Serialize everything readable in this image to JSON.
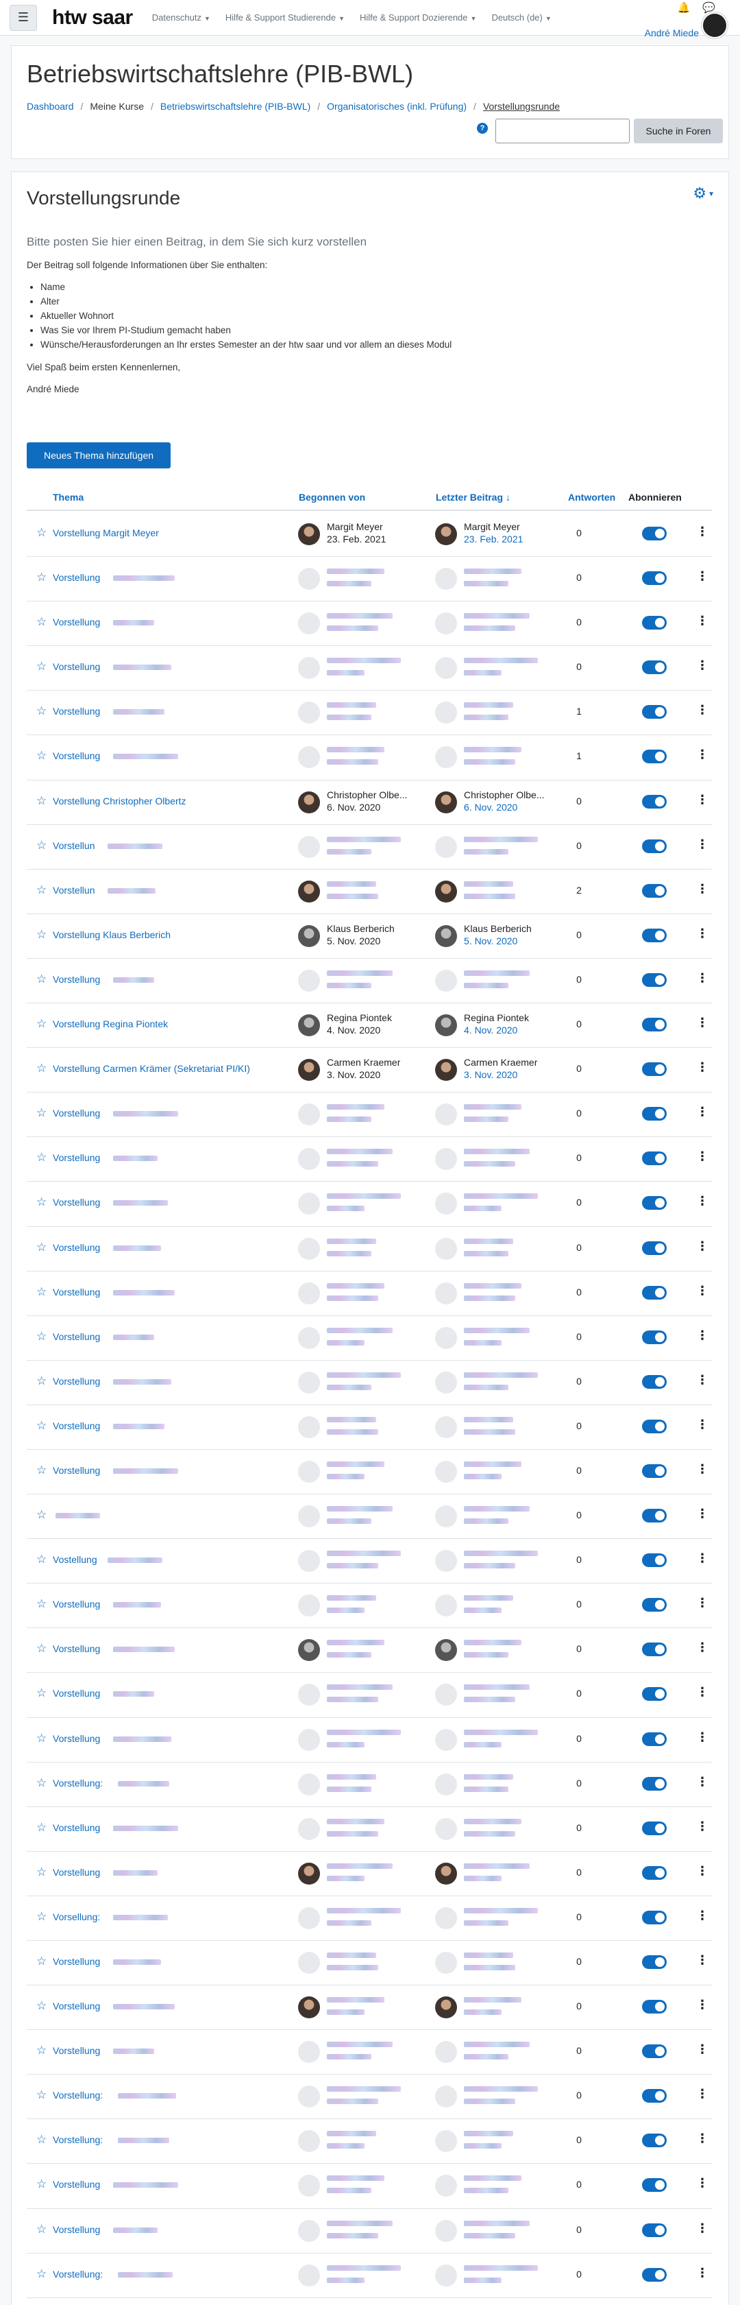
{
  "navbar": {
    "brand": "htw saar",
    "menu_icon": "hamburger-icon",
    "items": [
      {
        "label": "Datenschutz"
      },
      {
        "label": "Hilfe & Support Studierende"
      },
      {
        "label": "Hilfe & Support Dozierende"
      },
      {
        "label": "Deutsch (de)"
      }
    ],
    "user_name": "André Miede"
  },
  "header": {
    "title": "Betriebswirtschaftslehre (PIB-BWL)",
    "breadcrumb": [
      {
        "label": "Dashboard",
        "link": true
      },
      {
        "label": "Meine Kurse",
        "link": false
      },
      {
        "label": "Betriebswirtschaftslehre (PIB-BWL)",
        "link": true
      },
      {
        "label": "Organisatorisches (inkl. Prüfung)",
        "link": true
      },
      {
        "label": "Vorstellungsrunde",
        "link": false
      }
    ],
    "search_placeholder": "",
    "search_button": "Suche in Foren"
  },
  "forum": {
    "title": "Vorstellungsrunde",
    "intro_lead": "Bitte posten Sie hier einen Beitrag, in dem Sie sich kurz vorstellen",
    "intro_text": "Der Beitrag soll folgende Informationen über Sie enthalten:",
    "intro_items": [
      "Name",
      "Alter",
      "Aktueller Wohnort",
      "Was Sie vor Ihrem PI-Studium gemacht haben",
      "Wünsche/Herausforderungen an Ihr erstes Semester an der htw saar und vor allem an dieses Modul"
    ],
    "closing": "Viel Spaß beim ersten Kennenlernen,",
    "signature": "André Miede",
    "add_button": "Neues Thema hinzufügen"
  },
  "table": {
    "headers": {
      "topic": "Thema",
      "started_by": "Begonnen von",
      "last_post": "Letzter Beitrag",
      "replies": "Antworten",
      "subscribe": "Abonnieren"
    },
    "rows": [
      {
        "topic": "Vorstellung Margit Meyer",
        "starter": "Margit Meyer",
        "start_date": "23. Feb. 2021",
        "last": "Margit Meyer",
        "last_date": "23. Feb. 2021",
        "replies": "0",
        "avatar": "photo"
      },
      {
        "topic": "Vorstellung",
        "starter": "",
        "start_date": "",
        "last": "",
        "last_date": "",
        "replies": "0",
        "avatar": "blank"
      },
      {
        "topic": "Vorstellung",
        "starter": "",
        "start_date": "",
        "last": "",
        "last_date": "",
        "replies": "0",
        "avatar": "blank"
      },
      {
        "topic": "Vorstellung",
        "starter": "",
        "start_date": "",
        "last": "",
        "last_date": "",
        "replies": "0",
        "avatar": "blank"
      },
      {
        "topic": "Vorstellung",
        "starter": "",
        "start_date": "",
        "last": "",
        "last_date": "",
        "replies": "1",
        "avatar": "blank"
      },
      {
        "topic": "Vorstellung",
        "starter": "",
        "start_date": "",
        "last": "",
        "last_date": "",
        "replies": "1",
        "avatar": "blank"
      },
      {
        "topic": "Vorstellung Christopher Olbertz",
        "starter": "Christopher Olbe...",
        "start_date": "6. Nov. 2020",
        "last": "Christopher Olbe...",
        "last_date": "6. Nov. 2020",
        "replies": "0",
        "avatar": "photo"
      },
      {
        "topic": "Vorstellun",
        "starter": "",
        "start_date": "",
        "last": "",
        "last_date": "",
        "replies": "0",
        "avatar": "blank"
      },
      {
        "topic": "Vorstellun",
        "starter": "",
        "start_date": "",
        "last": "",
        "last_date": "",
        "replies": "2",
        "avatar": "photo"
      },
      {
        "topic": "Vorstellung Klaus Berberich",
        "starter": "Klaus Berberich",
        "start_date": "5. Nov. 2020",
        "last": "Klaus Berberich",
        "last_date": "5. Nov. 2020",
        "replies": "0",
        "avatar": "grey"
      },
      {
        "topic": "Vorstellung",
        "starter": "",
        "start_date": "",
        "last": "",
        "last_date": "",
        "replies": "0",
        "avatar": "blank"
      },
      {
        "topic": "Vorstellung Regina Piontek",
        "starter": "Regina Piontek",
        "start_date": "4. Nov. 2020",
        "last": "Regina Piontek",
        "last_date": "4. Nov. 2020",
        "replies": "0",
        "avatar": "grey"
      },
      {
        "topic": "Vorstellung Carmen Krämer (Sekretariat PI/KI)",
        "starter": "Carmen Kraemer",
        "start_date": "3. Nov. 2020",
        "last": "Carmen Kraemer",
        "last_date": "3. Nov. 2020",
        "replies": "0",
        "avatar": "photo"
      },
      {
        "topic": "Vorstellung",
        "starter": "",
        "start_date": "",
        "last": "",
        "last_date": "",
        "replies": "0",
        "avatar": "blank"
      },
      {
        "topic": "Vorstellung",
        "starter": "",
        "start_date": "",
        "last": "",
        "last_date": "",
        "replies": "0",
        "avatar": "blank"
      },
      {
        "topic": "Vorstellung",
        "starter": "",
        "start_date": "",
        "last": "",
        "last_date": "",
        "replies": "0",
        "avatar": "blank"
      },
      {
        "topic": "Vorstellung",
        "starter": "",
        "start_date": "",
        "last": "",
        "last_date": "",
        "replies": "0",
        "avatar": "blank"
      },
      {
        "topic": "Vorstellung",
        "starter": "",
        "start_date": "",
        "last": "",
        "last_date": "",
        "replies": "0",
        "avatar": "blank"
      },
      {
        "topic": "Vorstellung",
        "starter": "",
        "start_date": "",
        "last": "",
        "last_date": "",
        "replies": "0",
        "avatar": "blank"
      },
      {
        "topic": "Vorstellung",
        "starter": "",
        "start_date": "",
        "last": "",
        "last_date": "",
        "replies": "0",
        "avatar": "blank"
      },
      {
        "topic": "Vorstellung",
        "starter": "",
        "start_date": "",
        "last": "",
        "last_date": "",
        "replies": "0",
        "avatar": "blank"
      },
      {
        "topic": "Vorstellung",
        "starter": "",
        "start_date": "",
        "last": "",
        "last_date": "",
        "replies": "0",
        "avatar": "blank"
      },
      {
        "topic": "",
        "starter": "",
        "start_date": "",
        "last": "",
        "last_date": "",
        "replies": "0",
        "avatar": "blank"
      },
      {
        "topic": "Vostellung",
        "starter": "",
        "start_date": "",
        "last": "",
        "last_date": "",
        "replies": "0",
        "avatar": "blank"
      },
      {
        "topic": "Vorstellung",
        "starter": "",
        "start_date": "",
        "last": "",
        "last_date": "",
        "replies": "0",
        "avatar": "blank"
      },
      {
        "topic": "Vorstellung",
        "starter": "",
        "start_date": "",
        "last": "",
        "last_date": "",
        "replies": "0",
        "avatar": "grey"
      },
      {
        "topic": "Vorstellung",
        "starter": "",
        "start_date": "",
        "last": "",
        "last_date": "",
        "replies": "0",
        "avatar": "blank"
      },
      {
        "topic": "Vorstellung",
        "starter": "",
        "start_date": "",
        "last": "",
        "last_date": "",
        "replies": "0",
        "avatar": "blank"
      },
      {
        "topic": "Vorstellung:",
        "starter": "",
        "start_date": "",
        "last": "",
        "last_date": "",
        "replies": "0",
        "avatar": "blank"
      },
      {
        "topic": "Vorstellung",
        "starter": "",
        "start_date": "",
        "last": "",
        "last_date": "",
        "replies": "0",
        "avatar": "blank"
      },
      {
        "topic": "Vorstellung",
        "starter": "",
        "start_date": "",
        "last": "",
        "last_date": "",
        "replies": "0",
        "avatar": "photo"
      },
      {
        "topic": "Vorsellung:",
        "starter": "",
        "start_date": "",
        "last": "",
        "last_date": "",
        "replies": "0",
        "avatar": "blank"
      },
      {
        "topic": "Vorstellung",
        "starter": "",
        "start_date": "",
        "last": "",
        "last_date": "",
        "replies": "0",
        "avatar": "blank"
      },
      {
        "topic": "Vorstellung",
        "starter": "",
        "start_date": "",
        "last": "",
        "last_date": "",
        "replies": "0",
        "avatar": "photo"
      },
      {
        "topic": "Vorstellung",
        "starter": "",
        "start_date": "",
        "last": "",
        "last_date": "",
        "replies": "0",
        "avatar": "blank"
      },
      {
        "topic": "Vorstellung:",
        "starter": "",
        "start_date": "",
        "last": "",
        "last_date": "",
        "replies": "0",
        "avatar": "blank"
      },
      {
        "topic": "Vorstellung:",
        "starter": "",
        "start_date": "",
        "last": "",
        "last_date": "",
        "replies": "0",
        "avatar": "blank"
      },
      {
        "topic": "Vorstellung",
        "starter": "",
        "start_date": "",
        "last": "",
        "last_date": "",
        "replies": "0",
        "avatar": "blank"
      },
      {
        "topic": "Vorstellung",
        "starter": "",
        "start_date": "",
        "last": "",
        "last_date": "",
        "replies": "0",
        "avatar": "blank"
      },
      {
        "topic": "Vorstellung:",
        "starter": "",
        "start_date": "",
        "last": "",
        "last_date": "",
        "replies": "0",
        "avatar": "blank"
      }
    ]
  },
  "colors": {
    "accent": "#0f6cbf",
    "border": "#dee2e6",
    "text": "#1d2125"
  }
}
